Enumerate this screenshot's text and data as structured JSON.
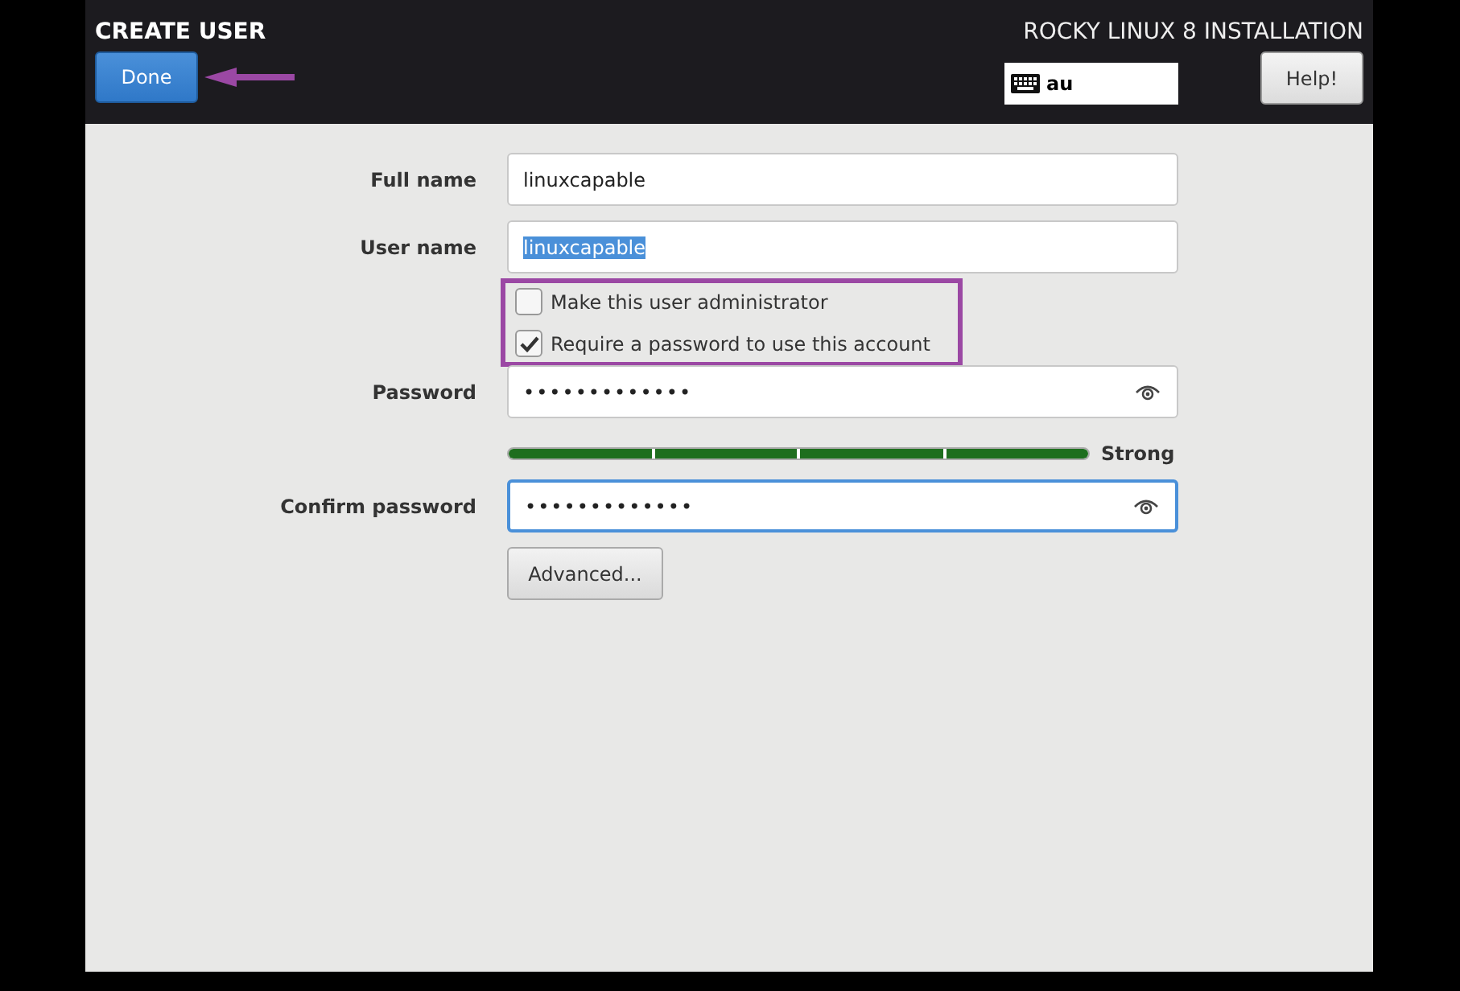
{
  "header": {
    "title": "CREATE USER",
    "done_button": "Done",
    "product": "ROCKY LINUX 8 INSTALLATION",
    "keyboard_layout": "au",
    "help_button": "Help!"
  },
  "fields": [
    {
      "kind": "text",
      "label": "Full name",
      "value": "linuxcapable",
      "text_selected": false,
      "focused": false
    },
    {
      "kind": "text",
      "label": "User name",
      "value": "linuxcapable",
      "text_selected": true,
      "focused": false
    },
    {
      "kind": "checks",
      "options": [
        {
          "label": "Make this user administrator",
          "checked": false
        },
        {
          "label": "Require a password to use this account",
          "checked": true
        }
      ]
    },
    {
      "kind": "password",
      "label": "Password",
      "value": "•••••••••••••",
      "focused": false
    },
    {
      "kind": "strength",
      "level": 1,
      "reading": "Strong"
    },
    {
      "kind": "password",
      "label": "Confirm password",
      "value": "•••••••••••••",
      "focused": true
    },
    {
      "kind": "button",
      "label": "Advanced..."
    }
  ],
  "annotations": {
    "done_arrow": true,
    "checks_frame": true
  }
}
